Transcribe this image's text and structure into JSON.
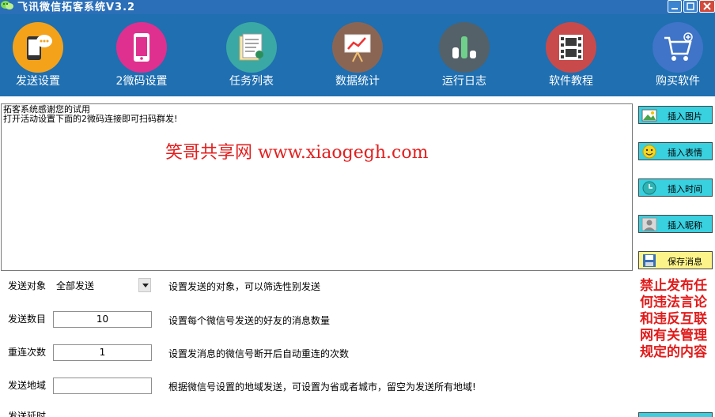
{
  "window": {
    "title": "飞讯微信拓客系统V3.2",
    "minimize_icon": "minimize-icon",
    "maximize_icon": "maximize-icon",
    "close_icon": "close-icon"
  },
  "toolbar": {
    "items": [
      {
        "label": "发送设置",
        "icon": "chat-phone-icon",
        "color": "#f4a21a"
      },
      {
        "label": "2微码设置",
        "icon": "smartphone-icon",
        "color": "#e0308f"
      },
      {
        "label": "任务列表",
        "icon": "document-list-icon",
        "color": "#3aa8a4"
      },
      {
        "label": "数据统计",
        "icon": "presentation-chart-icon",
        "color": "#8b6553"
      },
      {
        "label": "运行日志",
        "icon": "bar-chart-icon",
        "color": "#546168"
      },
      {
        "label": "软件教程",
        "icon": "film-icon",
        "color": "#c94a4a"
      },
      {
        "label": "购买软件",
        "icon": "shopping-cart-icon",
        "color": "#3f74c8"
      }
    ]
  },
  "message": {
    "line1": "拓客系统感谢您的试用",
    "line2": "打开活动设置下面的2微码连接即可扫码群发!",
    "watermark": "笑哥共享网  www.xiaogegh.com"
  },
  "side_buttons": {
    "insert_image": "插入图片",
    "insert_emoji": "插入表情",
    "insert_time": "插入时间",
    "insert_nickname": "插入昵称",
    "save_message": "保存消息"
  },
  "form": {
    "target": {
      "label": "发送对象",
      "value": "全部发送",
      "desc": "设置发送的对象，可以筛选性别发送"
    },
    "count": {
      "label": "发送数目",
      "value": "10",
      "desc": "设置每个微信号发送的好友的消息数量"
    },
    "retry": {
      "label": "重连次数",
      "value": "1",
      "desc": "设置发消息的微信号断开后自动重连的次数"
    },
    "region": {
      "label": "发送地域",
      "value": "",
      "desc": "根据微信号设置的地域发送，可设置为省或者城市，留空为发送所有地域!"
    },
    "partial_label": "发送延时"
  },
  "warning": "禁止发布任何违法言论和违反互联网有关管理规定的内容",
  "colors": {
    "titlebar": "#2a6fb8",
    "toolbar": "#1f6fb1",
    "cyan_button": "#39d0e0",
    "yellow_button": "#fcf48a",
    "warning": "#e11b1b"
  }
}
